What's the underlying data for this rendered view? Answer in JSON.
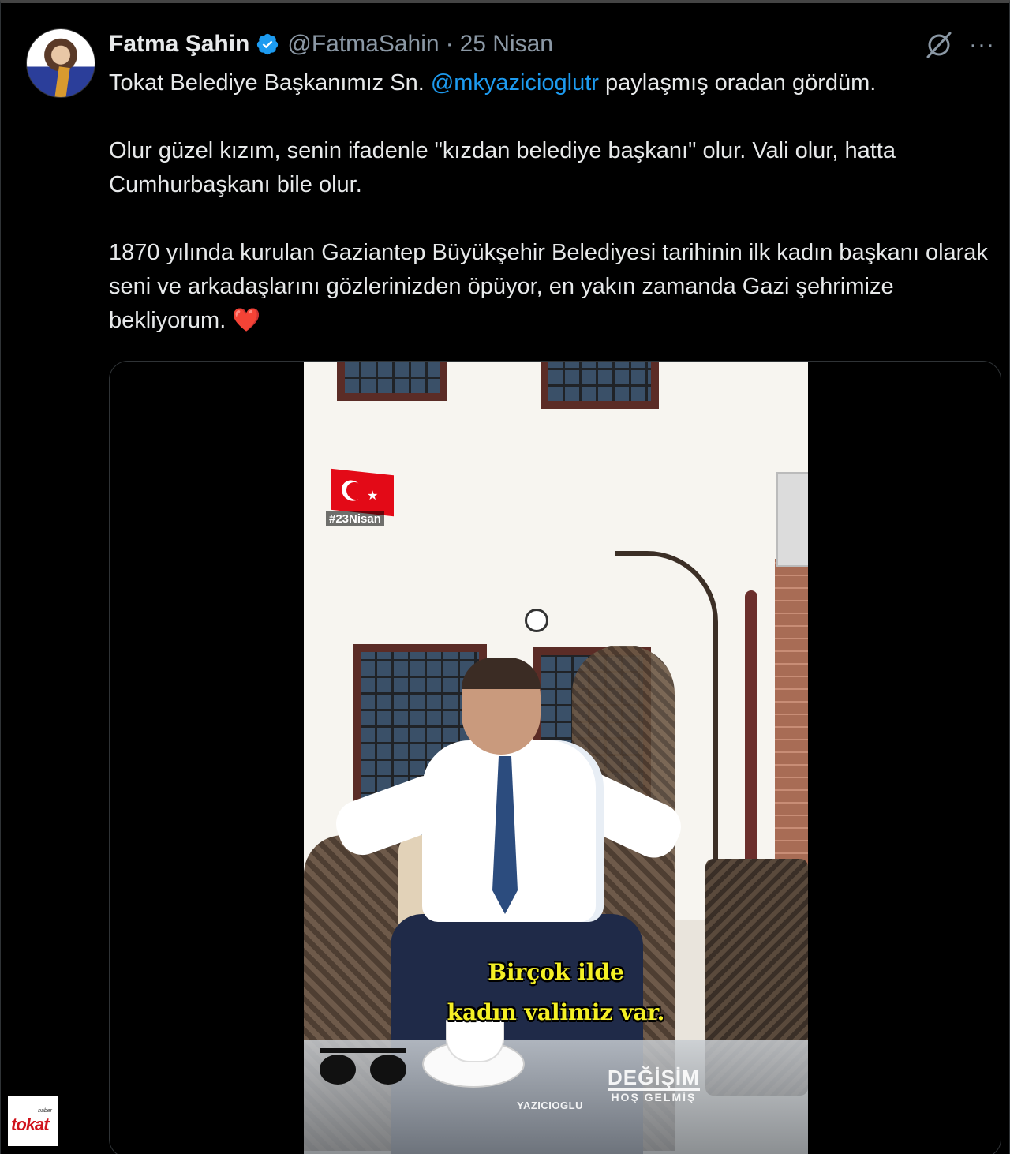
{
  "author": {
    "name": "Fatma Şahin",
    "handle": "@FatmaSahin",
    "separator": "·",
    "date": "25 Nisan",
    "verified_icon": "verified-badge-icon",
    "avatar_icon": "profile-photo"
  },
  "actions": {
    "grok_icon": "grok-icon",
    "more_label": "···"
  },
  "tweet": {
    "p1_before": "Tokat Belediye Başkanımız Sn. ",
    "p1_mention": "@mkyazicioglutr",
    "p1_after": " paylaşmış oradan gördüm.",
    "p2": "Olur güzel kızım, senin ifadenle \"kızdan belediye başkanı\" olur. Vali olur, hatta Cumhurbaşkanı bile olur.",
    "p3": "1870 yılında kurulan Gaziantep Büyükşehir Belediyesi tarihinin ilk kadın başkanı olarak seni ve arkadaşlarını gözlerinizden öpüyor, en yakın zamanda Gazi şehrimize bekliyorum. ",
    "heart": "❤️"
  },
  "video": {
    "hashtag": "#23Nisan",
    "subtitle_line1": "Birçok ilde",
    "subtitle_line2": "kadın valimiz var.",
    "logo_left": "YAZICIOGLU",
    "logo_right_big": "DEĞİŞİM",
    "logo_right_small": "HOŞ GELMİŞ"
  },
  "watermark": {
    "small": "haber",
    "brand": "tokat"
  },
  "colors": {
    "background": "#000000",
    "text": "#e7e9ea",
    "secondary": "#8b98a5",
    "link": "#1d9bf0",
    "verified": "#1d9bf0",
    "subtitle": "#f4f025"
  }
}
